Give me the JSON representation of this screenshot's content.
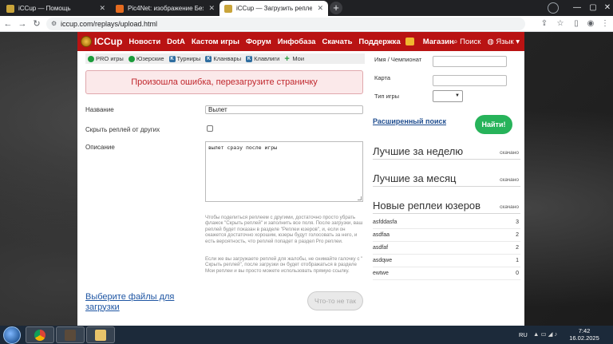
{
  "browser": {
    "tabs": [
      {
        "title": "iCCup — Помощь",
        "active": false
      },
      {
        "title": "Pic4Net: изображение Безымя...",
        "active": false
      },
      {
        "title": "iCCup — Загрузить реплей",
        "active": true
      }
    ],
    "url": "iccup.com/replays/upload.html"
  },
  "site": {
    "logo_text": "ICCup",
    "nav": [
      "Новости",
      "DotA",
      "Кастом игры",
      "Форум",
      "Инфобаза",
      "Скачать",
      "Поддержка",
      "Магазин"
    ],
    "search_label": "Поиск",
    "language_label": "Язык"
  },
  "filters": [
    {
      "label": "PRO игры",
      "icon": "pro-icon"
    },
    {
      "label": "Юзерские",
      "icon": "user-replays-icon"
    },
    {
      "label": "Турниры",
      "icon": "tournament-icon"
    },
    {
      "label": "Кланвары",
      "icon": "clanwar-icon"
    },
    {
      "label": "Клавлиги",
      "icon": "clanleague-icon"
    },
    {
      "label": "Мои",
      "icon": "plus-icon"
    }
  ],
  "form": {
    "error_message": "Произошла ошибка, перезагрузите страничку",
    "name_label": "Название",
    "name_value": "Вылет",
    "hide_label": "Скрыть реплей от других",
    "desc_label": "Описание",
    "desc_value": "вылет сразу после игры",
    "help_1": "Чтобы поделиться реплеем с другими, достаточно просто убрать флажок \"Скрыть реплей\" и заполнить все поля. После загрузки, ваш реплей будет показан в разделе \"Реплеи юзеров\", и, если он окажется достаточно хорошим, юзеры будут голосовать за него, и есть вероятность, что реплей попадет в раздел Pro реплеи.",
    "help_2": "Если же вы загружаете реплей для жалобы, не снимайте галочку с \" Скрыть реплей\", после загрузки он будет отображаться в разделе Мои реплеи и вы просто можете использовать прямую ссылку.",
    "choose_files": "Выберите файлы для загрузки",
    "submit_label": "Что-то не так"
  },
  "sidebar": {
    "name_label": "Имя / Чемпионат",
    "map_label": "Карта",
    "game_type_label": "Тип игры",
    "advanced_search": "Расширенный поиск",
    "find_button": "Найти!",
    "best_week": "Лучшие за неделю",
    "best_month": "Лучшие за месяц",
    "new_user_replays": "Новые реплеи юзеров",
    "downloaded": "скачано",
    "user_replays": [
      {
        "name": "asfddasfa",
        "count": "3"
      },
      {
        "name": "asdfaa",
        "count": "2"
      },
      {
        "name": "asdfaf",
        "count": "2"
      },
      {
        "name": "asdqwe",
        "count": "1"
      },
      {
        "name": "ewtwe",
        "count": "0"
      }
    ]
  },
  "taskbar": {
    "lang": "RU",
    "time": "7:42",
    "date": "16.02.2025"
  },
  "colors": {
    "brand_red": "#b91313",
    "error_text": "#c0272d",
    "find_green": "#27b35a",
    "link_blue": "#1f56a3"
  }
}
